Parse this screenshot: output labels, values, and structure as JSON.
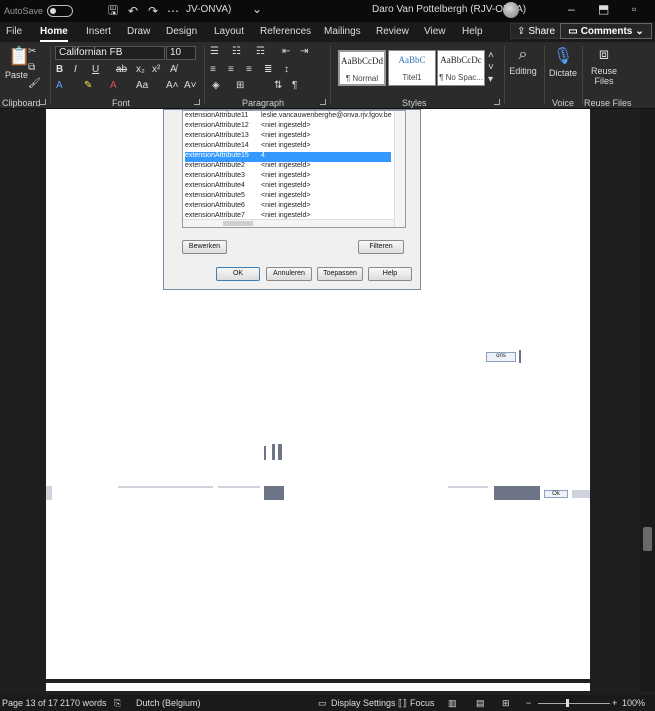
{
  "titlebar": {
    "autosave_label": "AutoSave",
    "doc_title": "JV-ONVA)",
    "user_name": "Daro Van Pottelbergh (RJV-ONVA)"
  },
  "tabs": [
    "File",
    "Home",
    "Insert",
    "Draw",
    "Design",
    "Layout",
    "References",
    "Mailings",
    "Review",
    "View",
    "Help"
  ],
  "share_label": "Share",
  "comments_label": "Comments",
  "ribbon": {
    "paste_label": "Paste",
    "font_name": "Californian FB",
    "font_size": "10",
    "styles": [
      {
        "sample": "AaBbCcDd",
        "name": "¶ Normal"
      },
      {
        "sample": "AaBbC",
        "name": "Titel1"
      },
      {
        "sample": "AaBbCcDc",
        "name": "¶ No Spac..."
      }
    ],
    "editing_label": "Editing",
    "dictate_label": "Dictate",
    "reuse_label": "Reuse Files",
    "groups": {
      "clipboard": "Clipboard",
      "font": "Font",
      "paragraph": "Paragraph",
      "styles": "Styles",
      "voice": "Voice",
      "reuse": "Reuse Files"
    }
  },
  "dialog": {
    "rows": [
      {
        "k": "extensionAttribute11",
        "v": "leslie.vancauwenberghe@onva.rjv.fgov.be"
      },
      {
        "k": "extensionAttribute12",
        "v": "<niet ingesteld>"
      },
      {
        "k": "extensionAttribute13",
        "v": "<niet ingesteld>"
      },
      {
        "k": "extensionAttribute14",
        "v": "<niet ingesteld>"
      },
      {
        "k": "extensionAttribute15",
        "v": "4"
      },
      {
        "k": "extensionAttribute2",
        "v": "<niet ingesteld>"
      },
      {
        "k": "extensionAttribute3",
        "v": "<niet ingesteld>"
      },
      {
        "k": "extensionAttribute4",
        "v": "<niet ingesteld>"
      },
      {
        "k": "extensionAttribute5",
        "v": "<niet ingesteld>"
      },
      {
        "k": "extensionAttribute6",
        "v": "<niet ingesteld>"
      },
      {
        "k": "extensionAttribute7",
        "v": "<niet ingesteld>"
      }
    ],
    "edit_btn": "Bewerken",
    "filter_btn": "Filteren",
    "ok_btn": "OK",
    "cancel_btn": "Annuleren",
    "apply_btn": "Toepassen",
    "help_btn": "Help"
  },
  "fragments": {
    "ons_text": "ons",
    "small_btn_text": "Ok"
  },
  "statusbar": {
    "page": "Page 13 of 17",
    "words": "2170 words",
    "language": "Dutch (Belgium)",
    "display_settings": "Display Settings",
    "focus": "Focus",
    "zoom": "100%"
  }
}
